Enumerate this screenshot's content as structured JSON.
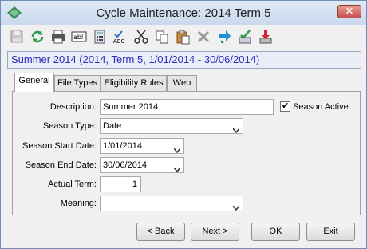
{
  "window": {
    "title": "Cycle Maintenance: 2014 Term 5",
    "close_glyph": "✕"
  },
  "toolbar": {
    "buttons": [
      {
        "icon": "save-icon"
      },
      {
        "icon": "refresh-icon"
      },
      {
        "icon": "print-icon"
      },
      {
        "icon": "text-field-icon"
      },
      {
        "icon": "calculator-icon"
      },
      {
        "icon": "spellcheck-icon"
      },
      {
        "icon": "cut-icon"
      },
      {
        "icon": "copy-icon"
      },
      {
        "icon": "paste-icon"
      },
      {
        "icon": "delete-icon"
      },
      {
        "icon": "move-icon"
      },
      {
        "icon": "approve-icon"
      },
      {
        "icon": "download-icon"
      }
    ]
  },
  "banner": {
    "text": "Summer 2014 (2014, Term 5, 1/01/2014 - 30/06/2014)"
  },
  "tabs": [
    {
      "label": "General",
      "active": true
    },
    {
      "label": "File Types",
      "active": false
    },
    {
      "label": "Eligibility Rules",
      "active": false
    },
    {
      "label": "Web",
      "active": false
    }
  ],
  "form": {
    "description": {
      "label": "Description:",
      "value": "Summer 2014"
    },
    "season_active": {
      "label": "Season Active",
      "checked": true,
      "check_glyph": "✔"
    },
    "season_type": {
      "label": "Season Type:",
      "value": "Date"
    },
    "season_start": {
      "label": "Season Start Date:",
      "value": "1/01/2014"
    },
    "season_end": {
      "label": "Season End Date:",
      "value": "30/06/2014"
    },
    "actual_term": {
      "label": "Actual Term:",
      "value": "1"
    },
    "meaning": {
      "label": "Meaning:",
      "value": ""
    }
  },
  "buttons": {
    "back": "< Back",
    "next": "Next >",
    "ok": "OK",
    "exit": "Exit"
  }
}
